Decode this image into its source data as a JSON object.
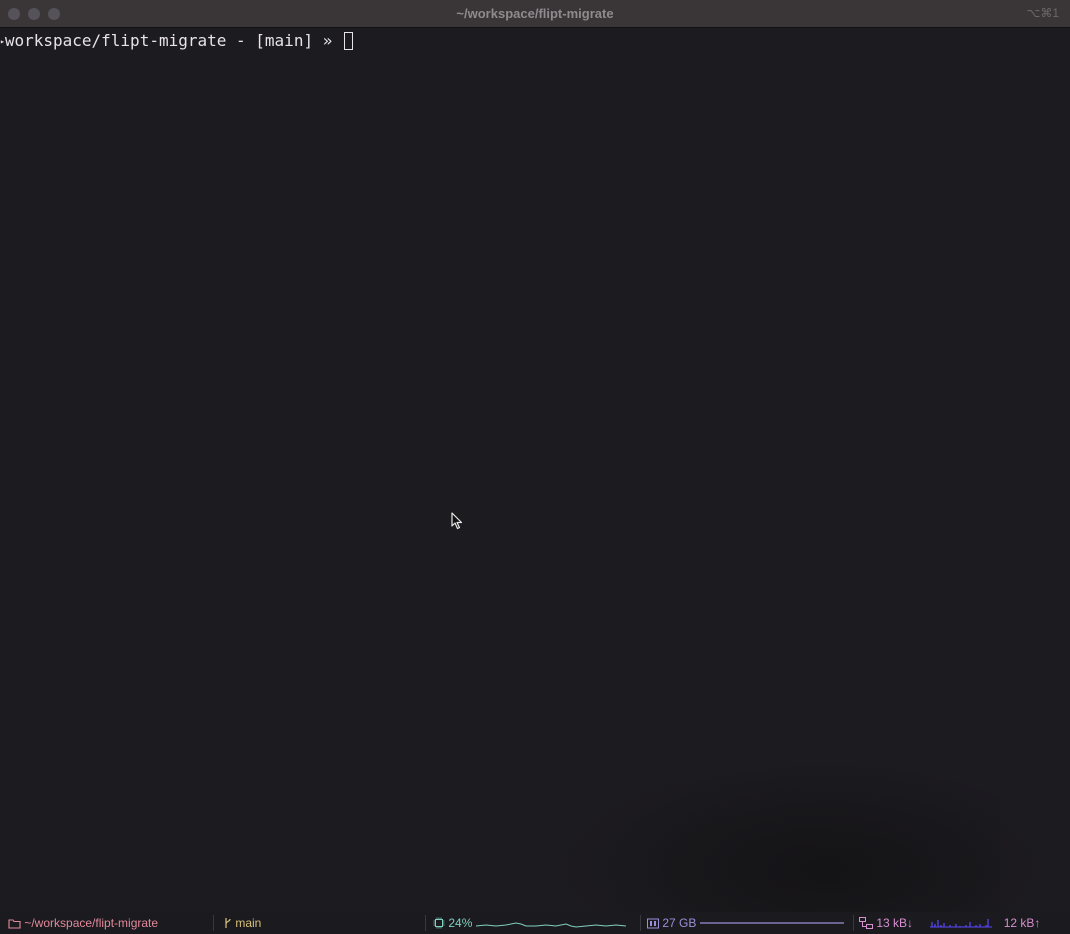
{
  "window": {
    "title": "~/workspace/flipt-migrate",
    "shortcut": "⌥⌘1"
  },
  "terminal": {
    "prompt_marker": "▸",
    "prompt": "workspace/flipt-migrate - [main] » "
  },
  "statusbar": {
    "path": "~/workspace/flipt-migrate",
    "branch": "main",
    "cpu": "24%",
    "memory": "27 GB",
    "net_down": "13 kB↓",
    "net_up": "12 kB↑"
  },
  "colors": {
    "path": "#e08a9a",
    "branch": "#d8c27a",
    "cpu": "#7fd1c0",
    "memory": "#9b8fd8",
    "net": "#d68fd0",
    "net_graph": "#5a48ff"
  },
  "icons": {
    "folder": "folder-icon",
    "branch": "git-branch-icon",
    "cpu": "cpu-icon",
    "memory": "memory-icon",
    "network": "network-icon"
  }
}
